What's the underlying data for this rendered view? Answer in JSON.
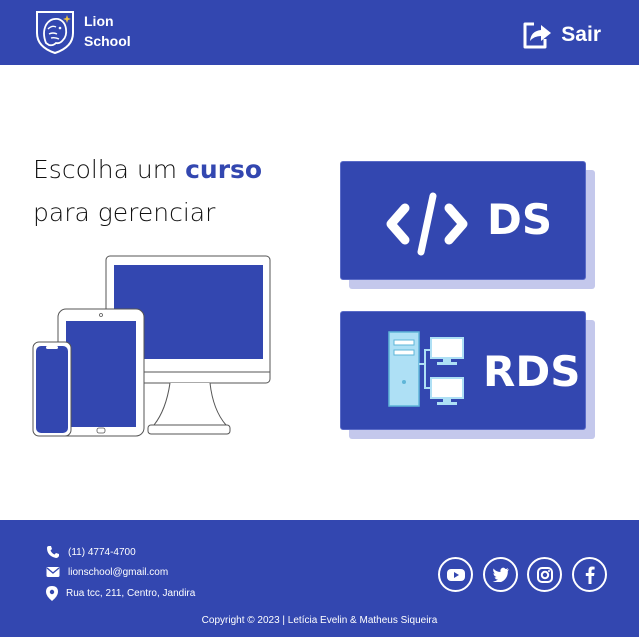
{
  "header": {
    "brand_line1": "Lion",
    "brand_line2": "School",
    "logout_label": "Sair"
  },
  "hero": {
    "line1_prefix": "Escolha um ",
    "line1_accent": "curso",
    "line2": "para gerenciar"
  },
  "courses": [
    {
      "label": "DS",
      "icon": "code-icon"
    },
    {
      "label": "RDS",
      "icon": "network-icon"
    }
  ],
  "footer": {
    "phone": "(11) 4774-4700",
    "email": "lionschool@gmail.com",
    "address": "Rua tcc, 211, Centro, Jandira",
    "copyright": "Copyright © 2023 | Letícia Evelin & Matheus Siqueira",
    "social": [
      "youtube-icon",
      "twitter-icon",
      "instagram-icon",
      "facebook-icon"
    ]
  },
  "colors": {
    "primary": "#3347b0",
    "shadow": "#c4c8ec",
    "light_blue": "#aee0f5"
  }
}
